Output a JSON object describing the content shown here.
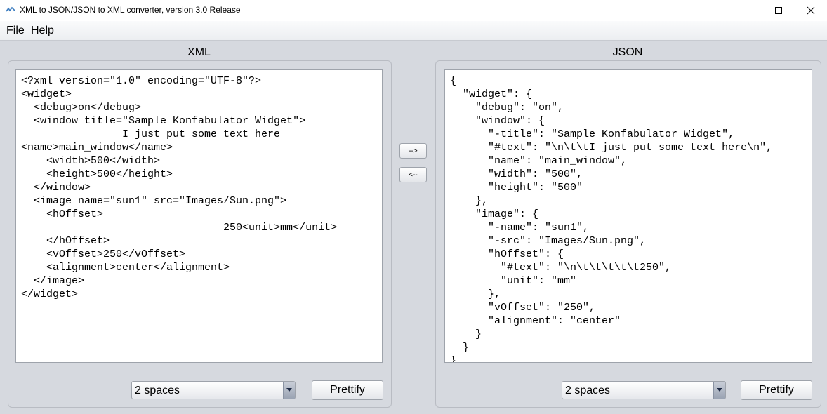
{
  "window": {
    "title": "XML to JSON/JSON to XML converter, version 3.0 Release"
  },
  "menu": {
    "items": [
      "File",
      "Help"
    ]
  },
  "xml_panel": {
    "label": "XML",
    "content": "<?xml version=\"1.0\" encoding=\"UTF-8\"?>\n<widget>\n  <debug>on</debug>\n  <window title=\"Sample Konfabulator Widget\">\n                I just put some text here\n<name>main_window</name>\n    <width>500</width>\n    <height>500</height>\n  </window>\n  <image name=\"sun1\" src=\"Images/Sun.png\">\n    <hOffset>\n                                250<unit>mm</unit>\n    </hOffset>\n    <vOffset>250</vOffset>\n    <alignment>center</alignment>\n  </image>\n</widget>",
    "indent_selected": "2 spaces",
    "prettify_label": "Prettify"
  },
  "json_panel": {
    "label": "JSON",
    "content": "{\n  \"widget\": {\n    \"debug\": \"on\",\n    \"window\": {\n      \"-title\": \"Sample Konfabulator Widget\",\n      \"#text\": \"\\n\\t\\tI just put some text here\\n\",\n      \"name\": \"main_window\",\n      \"width\": \"500\",\n      \"height\": \"500\"\n    },\n    \"image\": {\n      \"-name\": \"sun1\",\n      \"-src\": \"Images/Sun.png\",\n      \"hOffset\": {\n        \"#text\": \"\\n\\t\\t\\t\\t\\t250\",\n        \"unit\": \"mm\"\n      },\n      \"vOffset\": \"250\",\n      \"alignment\": \"center\"\n    }\n  }\n}",
    "indent_selected": "2 spaces",
    "prettify_label": "Prettify"
  },
  "convert": {
    "to_json_label": "-->",
    "to_xml_label": "<--"
  }
}
